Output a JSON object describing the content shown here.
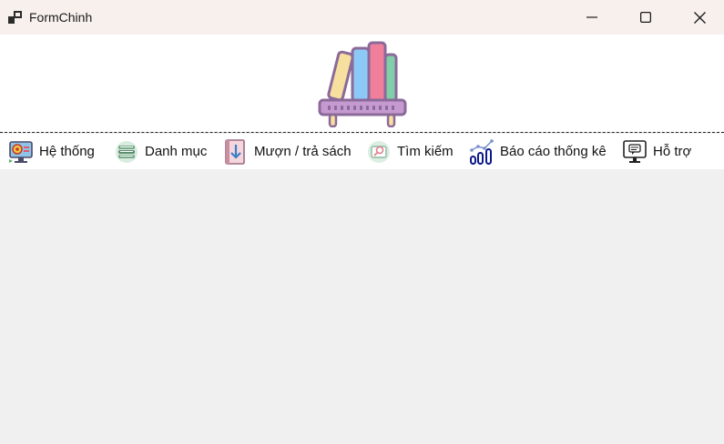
{
  "window": {
    "title": "FormChinh",
    "app_icon": "window-app-icon",
    "controls": {
      "minimize_icon": "minimize-icon",
      "maximize_icon": "maximize-icon",
      "close_icon": "close-icon"
    }
  },
  "banner": {
    "logo_icon": "bookshelf-icon"
  },
  "menu": {
    "items": [
      {
        "label": "Hệ thống",
        "icon": "system-monitor-icon"
      },
      {
        "label": "Danh mục",
        "icon": "category-stack-icon"
      },
      {
        "label": "Mượn / trả sách",
        "icon": "book-download-icon"
      },
      {
        "label": "Tìm kiếm",
        "icon": "search-icon"
      },
      {
        "label": "Báo cáo thống kê",
        "icon": "report-chart-icon"
      },
      {
        "label": "Hỗ trợ",
        "icon": "support-monitor-icon"
      }
    ]
  },
  "colors": {
    "titlebar_bg": "#f7f0ed",
    "content_bg": "#f0f0f0",
    "menubar_bg": "#ffffff"
  }
}
